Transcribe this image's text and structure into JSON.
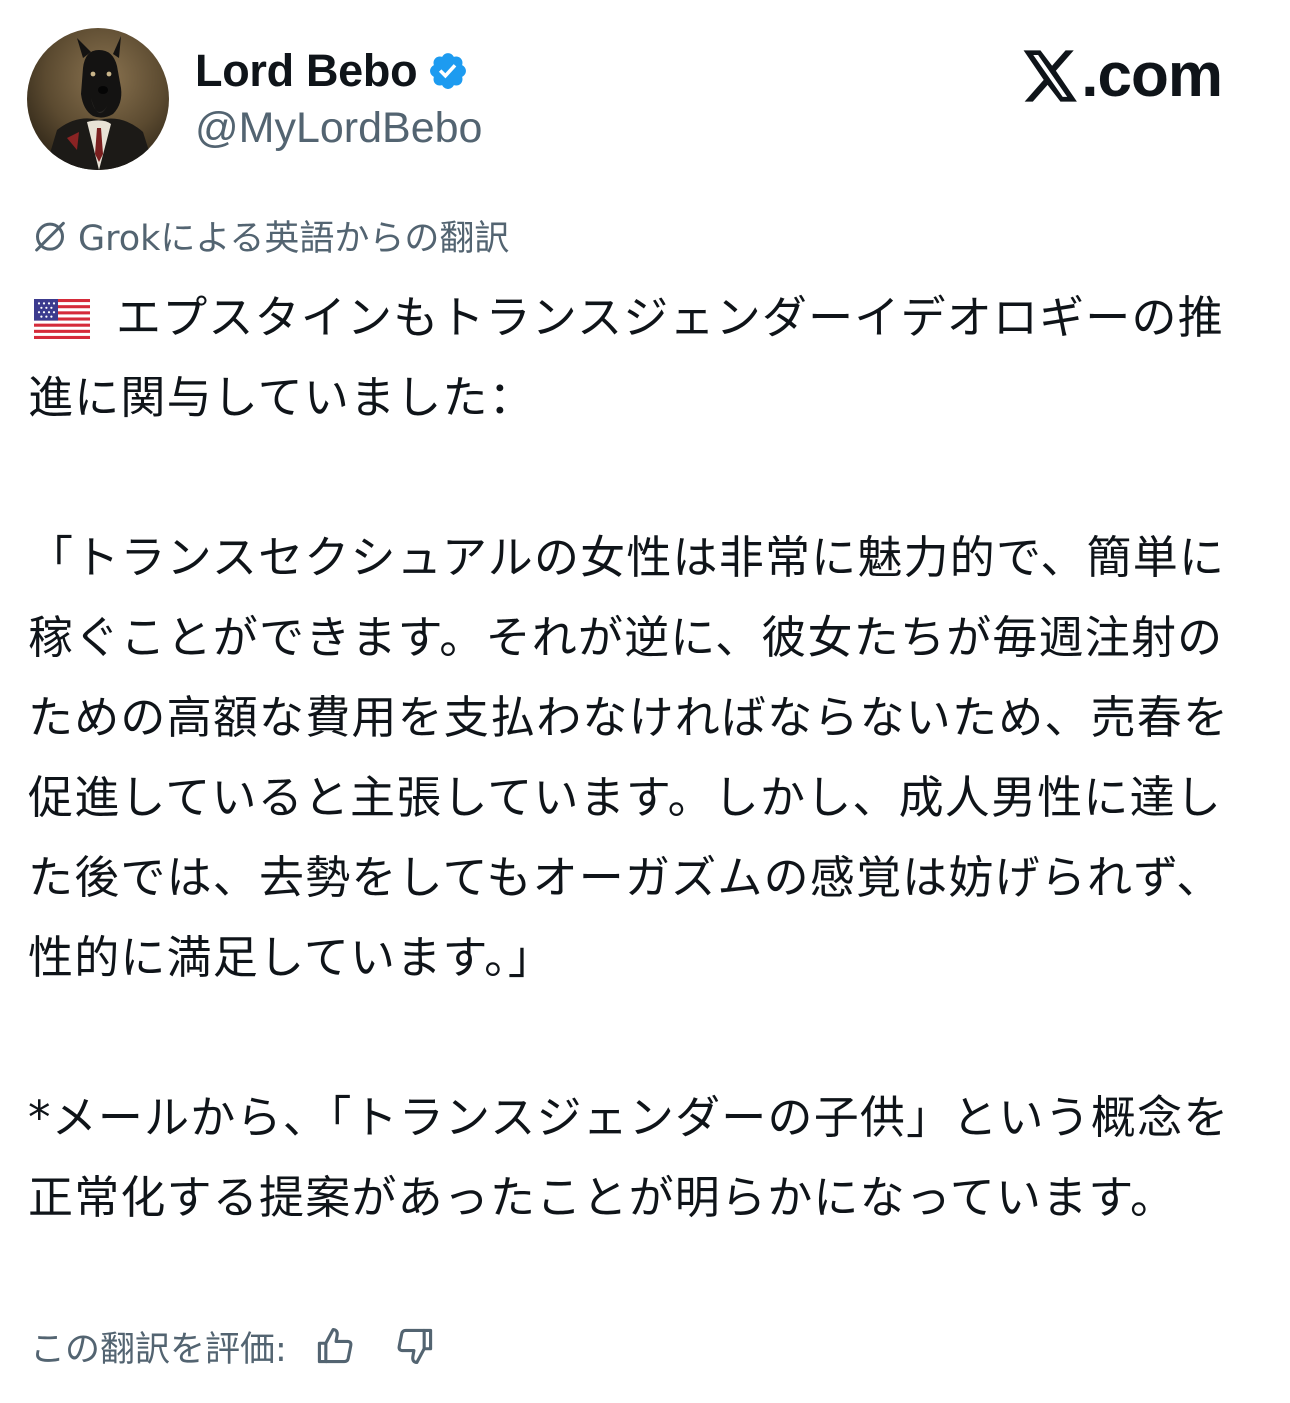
{
  "header": {
    "display_name": "Lord Bebo",
    "handle": "@MyLordBebo",
    "brand": ".com",
    "avatar_icon": "dog-in-suit-avatar",
    "verified_icon": "verified-badge-icon",
    "brand_icon": "x-logo-icon"
  },
  "translation": {
    "note": "Grokによる英語からの翻訳",
    "icon": "slashed-circle-icon"
  },
  "tweet": {
    "flag_icon": "us-flag-emoji",
    "line1": "エプスタインもトランスジェンダーイデオロギーの推進に関与していました：",
    "quote": "「トランスセクシュアルの女性は非常に魅力的で、簡単に稼ぐことができます。それが逆に、彼女たちが毎週注射のための高額な費用を支払わなければならないため、売春を促進していると主張しています。しかし、成人男性に達した後では、去勢をしてもオーガズムの感覚は妨げられず、性的に満足しています。」",
    "note": "*メールから、「トランスジェンダーの子供」という概念を正常化する提案があったことが明らかになっています。"
  },
  "rating": {
    "label": "この翻訳を評価:",
    "thumbs_up_icon": "thumbs-up-icon",
    "thumbs_down_icon": "thumbs-down-icon"
  },
  "colors": {
    "text": "#0f1419",
    "secondary": "#536471",
    "verified": "#1d9bf0"
  }
}
